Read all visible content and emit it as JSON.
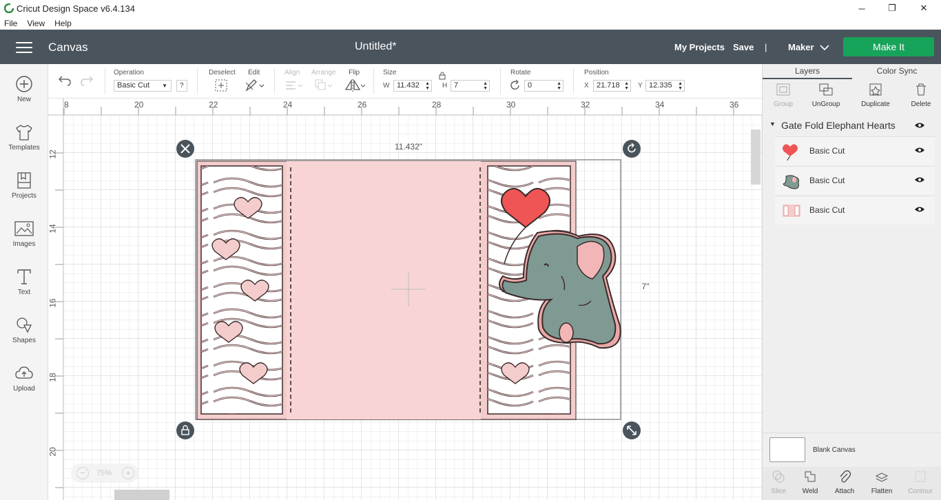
{
  "app": {
    "title": "Cricut Design Space  v6.4.134",
    "win_minimize": "─",
    "win_restore": "❐",
    "win_close": "✕"
  },
  "menu": [
    "File",
    "View",
    "Help"
  ],
  "header": {
    "section": "Canvas",
    "doc_title": "Untitled*",
    "my_projects": "My Projects",
    "save": "Save",
    "divider": "|",
    "machine": "Maker",
    "make_it": "Make It",
    "brand_color": "#17a35a"
  },
  "leftbar": [
    {
      "label": "New",
      "icon": "plus-circle-icon"
    },
    {
      "label": "Templates",
      "icon": "tshirt-icon"
    },
    {
      "label": "Projects",
      "icon": "projects-icon"
    },
    {
      "label": "Images",
      "icon": "image-icon"
    },
    {
      "label": "Text",
      "icon": "text-icon"
    },
    {
      "label": "Shapes",
      "icon": "shapes-icon"
    },
    {
      "label": "Upload",
      "icon": "cloud-upload-icon"
    }
  ],
  "toolbar": {
    "operation_label": "Operation",
    "operation_value": "Basic Cut",
    "operation_help": "?",
    "deselect": "Deselect",
    "edit": "Edit",
    "align": "Align",
    "arrange": "Arrange",
    "flip": "Flip",
    "size_label": "Size",
    "w_label": "W",
    "w_value": "11.432",
    "h_label": "H",
    "h_value": "7",
    "rotate_label": "Rotate",
    "rotate_value": "0",
    "position_label": "Position",
    "x_label": "X",
    "x_value": "21.718",
    "y_label": "Y",
    "y_value": "12.335"
  },
  "canvas": {
    "ruler_top": [
      "8",
      "20",
      "22",
      "24",
      "26",
      "28",
      "30",
      "32",
      "34",
      "36"
    ],
    "ruler_left": [
      "12",
      "14",
      "16",
      "18",
      "20"
    ],
    "width_dim": "11.432\"",
    "height_dim": "7\"",
    "zoom": "75%",
    "zoom_minus": "−",
    "zoom_plus": "+"
  },
  "rightpanel": {
    "tabs": [
      "Layers",
      "Color Sync"
    ],
    "tools": [
      {
        "label": "Group",
        "icon": "group-icon",
        "enabled": false
      },
      {
        "label": "UnGroup",
        "icon": "ungroup-icon",
        "enabled": true
      },
      {
        "label": "Duplicate",
        "icon": "duplicate-icon",
        "enabled": true
      },
      {
        "label": "Delete",
        "icon": "trash-icon",
        "enabled": true
      }
    ],
    "group_name": "Gate Fold Elephant Hearts",
    "layers": [
      {
        "name": "Basic Cut",
        "thumb": "balloon-thumb"
      },
      {
        "name": "Basic Cut",
        "thumb": "elephant-thumb"
      },
      {
        "name": "Basic Cut",
        "thumb": "card-thumb"
      }
    ],
    "blank_canvas": "Blank Canvas",
    "bottom_tools": [
      {
        "label": "Slice",
        "icon": "slice-icon",
        "enabled": false
      },
      {
        "label": "Weld",
        "icon": "weld-icon",
        "enabled": true
      },
      {
        "label": "Attach",
        "icon": "attach-icon",
        "enabled": true
      },
      {
        "label": "Flatten",
        "icon": "flatten-icon",
        "enabled": true
      },
      {
        "label": "Contour",
        "icon": "contour-icon",
        "enabled": false
      }
    ]
  }
}
